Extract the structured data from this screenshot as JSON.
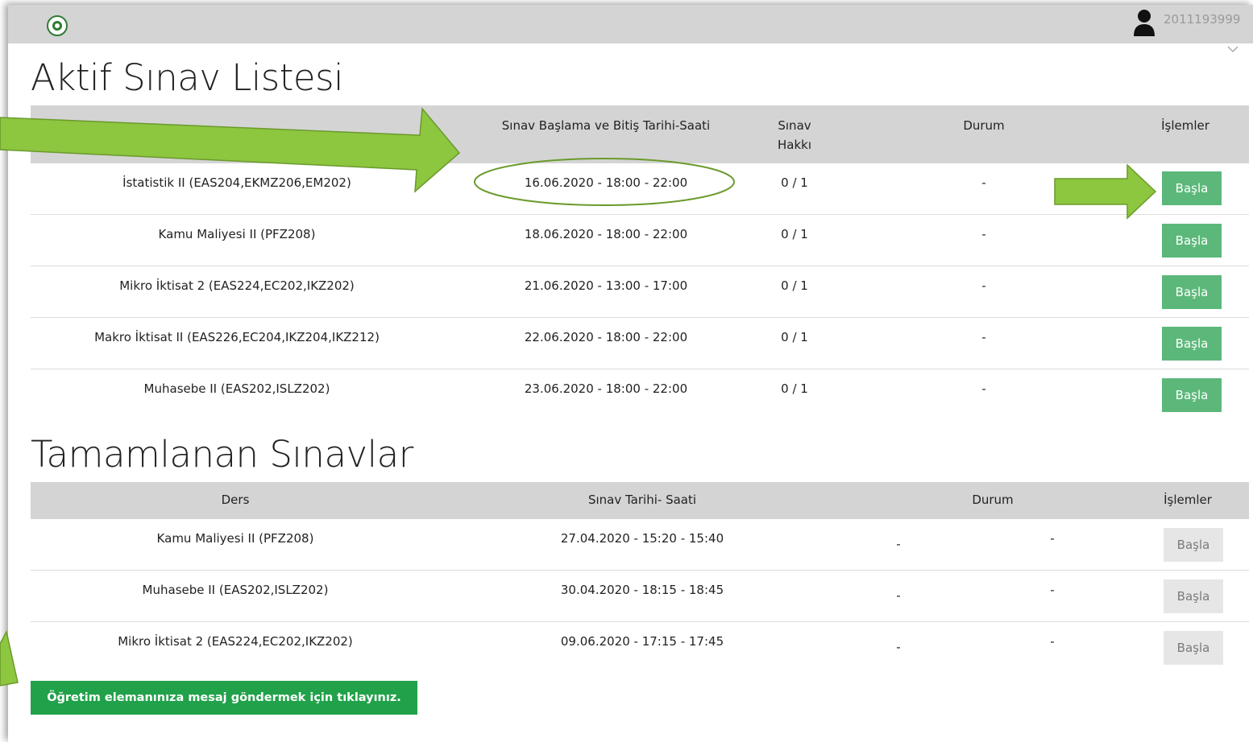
{
  "header": {
    "user_id": "2011193999"
  },
  "active": {
    "title": "Aktif Sınav Listesi",
    "columns": {
      "date": "Sınav Başlama ve Bitiş Tarihi-Saati",
      "right_line1": "Sınav",
      "right_line2": "Hakkı",
      "status": "Durum",
      "actions": "İşlemler"
    },
    "rows": [
      {
        "course": "İstatistik II (EAS204,EKMZ206,EM202)",
        "date": "16.06.2020 - 18:00 - 22:00",
        "right": "0 / 1",
        "status": "-",
        "button": "Başla"
      },
      {
        "course": "Kamu Maliyesi II (PFZ208)",
        "date": "18.06.2020 - 18:00 - 22:00",
        "right": "0 / 1",
        "status": "-",
        "button": "Başla"
      },
      {
        "course": "Mikro İktisat 2 (EAS224,EC202,IKZ202)",
        "date": "21.06.2020 - 13:00 - 17:00",
        "right": "0 / 1",
        "status": "-",
        "button": "Başla"
      },
      {
        "course": "Makro İktisat II (EAS226,EC204,IKZ204,IKZ212)",
        "date": "22.06.2020 - 18:00 - 22:00",
        "right": "0 / 1",
        "status": "-",
        "button": "Başla"
      },
      {
        "course": "Muhasebe II (EAS202,ISLZ202)",
        "date": "23.06.2020 - 18:00 - 22:00",
        "right": "0 / 1",
        "status": "-",
        "button": "Başla"
      }
    ]
  },
  "completed": {
    "title": "Tamamlanan Sınavlar",
    "columns": {
      "course": "Ders",
      "date": "Sınav Tarihi- Saati",
      "status": "Durum",
      "actions": "İşlemler"
    },
    "rows": [
      {
        "course": "Kamu Maliyesi II (PFZ208)",
        "date": "27.04.2020 - 15:20 - 15:40",
        "status_a": "-",
        "status_b": "-",
        "button": "Başla"
      },
      {
        "course": "Muhasebe II (EAS202,ISLZ202)",
        "date": "30.04.2020 - 18:15 - 18:45",
        "status_a": "-",
        "status_b": "-",
        "button": "Başla"
      },
      {
        "course": "Mikro İktisat 2 (EAS224,EC202,IKZ202)",
        "date": "09.06.2020 - 17:15 - 17:45",
        "status_a": "-",
        "status_b": "-",
        "button": "Başla"
      }
    ]
  },
  "message_button": "Öğretim elemanınıza mesaj göndermek için tıklayınız.",
  "colors": {
    "start_button": "#5cb87a",
    "message_button": "#21a24a",
    "annotation_arrow": "#8dc63f",
    "header_bar": "#d4d4d4"
  }
}
